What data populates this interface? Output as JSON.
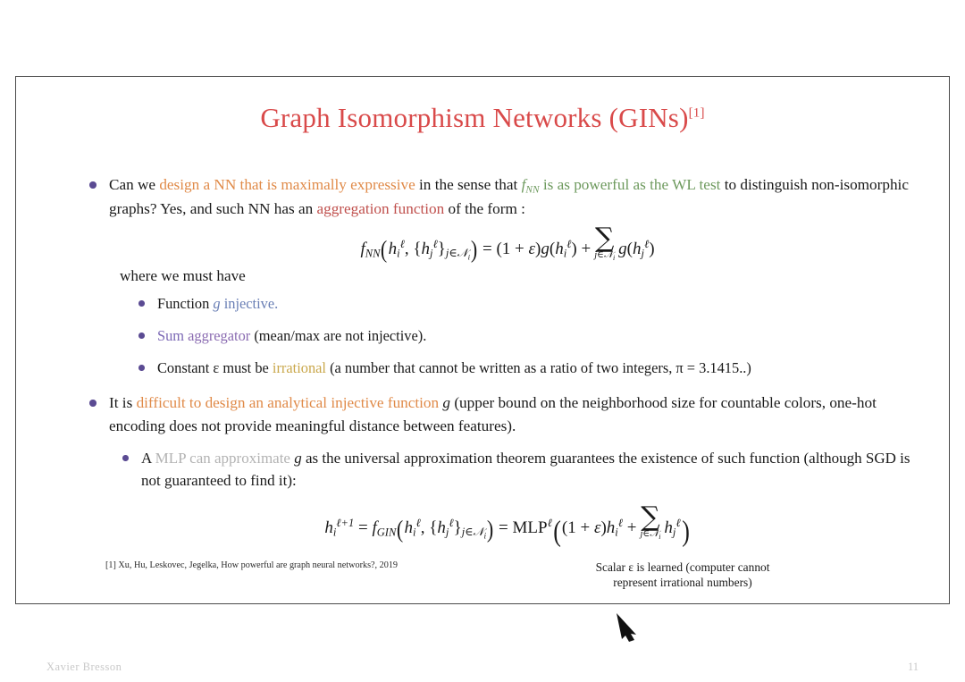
{
  "slide": {
    "title_main": "Graph Isomorphism Networks (GINs)",
    "title_sup": "[1]",
    "title_color": "#d94a4a"
  },
  "bullet1": {
    "part1": "Can we ",
    "highlight_orange": "design a NN that is maximally expressive",
    "part2": " in the sense that ",
    "math_fnn": "f",
    "math_fnn_sub": "NN",
    "highlight_green_a": " is as powerful as the",
    "highlight_green_b": "WL test",
    "part3": " to distinguish non-isomorphic graphs? Yes, and such NN has an ",
    "highlight_red": "aggregation function",
    "part4": " of the form :"
  },
  "where_line": "where we must have",
  "equation1": {
    "lhs_f": "f",
    "lhs_sub": "NN",
    "args": "( h",
    "full_text": "f_NN( h_i^l, {h_j^l}_{j in N_i} ) = (1 + e) g(h_i^l) + Sum_{j in N_i} g(h_j^l)",
    "sum_limit": "j∈",
    "sum_limit_n": "N",
    "sum_limit_i": "i"
  },
  "sub_bullets": [
    {
      "pre": "Function ",
      "math": "g",
      "colored": " injective.",
      "post": ""
    },
    {
      "pre": "",
      "colored_sum": "Sum",
      "colored_agg": " aggregator",
      "post": " (mean/max are not injective)."
    },
    {
      "pre": "Constant ε must be ",
      "colored_gold": "irrational",
      "post": " (a number that cannot be written as a ratio of two integers, π = 3.1415..)"
    }
  ],
  "bullet2": {
    "part1": "It is ",
    "highlight_orange": "difficult to design an analytical injective function",
    "math_g": "g",
    "part2": " (upper bound on the neighborhood size for countable colors, one-hot encoding does not provide meaningful distance between features)."
  },
  "bullet3": {
    "part1": "A ",
    "highlight_gray": "MLP can approximate",
    "math_g": "g",
    "part2": " as the universal approximation theorem guarantees the existence of such function (although SGD is not guaranteed to find it):"
  },
  "equation2": {
    "full_text": "h_i^{l+1} = f_GIN( h_i^l, {h_j^l}_{j in N_i} ) = MLP^l( (1 + e) h_i^l + Sum_{j in N_i} h_j^l )"
  },
  "annotation": {
    "line1": "Scalar ε is learned (computer cannot",
    "line2": "represent irrational numbers)"
  },
  "footnote": "[1] Xu, Hu, Leskovec, Jegelka, How powerful are graph neural networks?, 2019",
  "footer": {
    "author": "Xavier Bresson",
    "page": "11"
  },
  "colors": {
    "title": "#d94a4a",
    "orange": "#e08a48",
    "green": "#6e9a5e",
    "red": "#c0504d",
    "blue": "#6a7fb5",
    "purple": "#8a6bb1",
    "gold": "#c9a74a",
    "gray": "#b3b3b3",
    "bullet": "#5b4b93",
    "frame": "#4a4a4a"
  }
}
